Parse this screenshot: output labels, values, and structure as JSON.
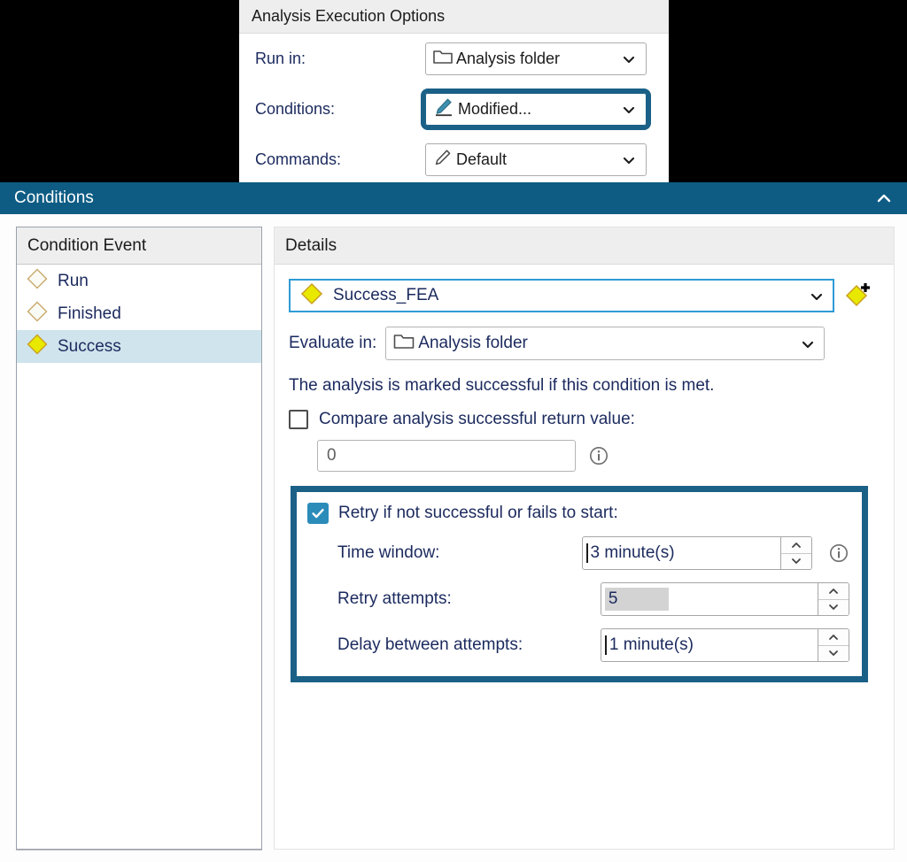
{
  "analysis_execution_options": {
    "title": "Analysis Execution Options",
    "rows": [
      {
        "label": "Run in:",
        "value": "Analysis folder",
        "icon": "folder-icon",
        "highlighted": false
      },
      {
        "label": "Conditions:",
        "value": "Modified...",
        "icon": "pencil-solid-icon",
        "highlighted": true
      },
      {
        "label": "Commands:",
        "value": "Default",
        "icon": "pencil-outline-icon",
        "highlighted": false
      }
    ]
  },
  "conditions_window": {
    "title": "Conditions",
    "collapse_icon": "chevron-up-icon",
    "event_list": {
      "header": "Condition Event",
      "items": [
        {
          "label": "Run",
          "icon": "diamond-empty-icon",
          "selected": false
        },
        {
          "label": "Finished",
          "icon": "diamond-empty-icon",
          "selected": false
        },
        {
          "label": "Success",
          "icon": "diamond-yellow-icon",
          "selected": true
        }
      ]
    },
    "details": {
      "header": "Details",
      "condition_select": {
        "value": "Success_FEA",
        "icon": "diamond-yellow-icon",
        "dropdown_icon": "chevron-down-icon",
        "add_button_icon": "add-diamond-icon"
      },
      "evaluate_in": {
        "label": "Evaluate in:",
        "value": "Analysis folder",
        "icon": "folder-icon",
        "dropdown_icon": "chevron-down-icon"
      },
      "description": "The analysis is marked successful if this condition is met.",
      "compare_return_value": {
        "label": "Compare analysis successful return value:",
        "checked": false,
        "input_value": "0",
        "info_icon": "info-icon"
      },
      "retry_group": {
        "label": "Retry if not successful or fails to start:",
        "checked": true,
        "highlighted": true,
        "info_icon": "info-icon",
        "fields": [
          {
            "label": "Time window:",
            "value": "3 minute(s)",
            "selected_text": false,
            "has_info": true
          },
          {
            "label": "Retry attempts:",
            "value": "5",
            "selected_text": true,
            "has_info": false
          },
          {
            "label": "Delay between attempts:",
            "value": "1 minute(s)",
            "selected_text": false,
            "has_info": false
          }
        ],
        "spinner_up_icon": "chevron-up-icon",
        "spinner_down_icon": "chevron-down-icon"
      }
    }
  },
  "colors": {
    "accent_blue": "#0e5c84",
    "highlight_border": "#1a6087",
    "focus_border": "#2e9bd6",
    "checkbox_checked": "#2b8cba",
    "diamond_yellow": "#e8e800",
    "selection_row": "#cfe4ec",
    "text_navy": "#1b2a5e"
  }
}
